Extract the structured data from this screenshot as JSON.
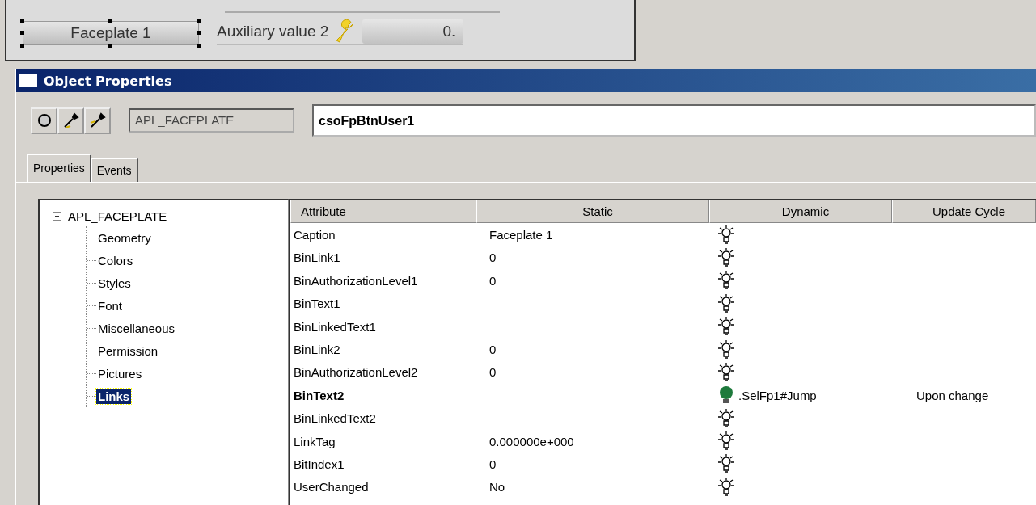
{
  "canvas": {
    "button": "Faceplate 1",
    "aux_label": "Auxiliary value 2",
    "aux_value": "0."
  },
  "window": {
    "title": "Object Properties"
  },
  "toolbar": {
    "type_field": "APL_FACEPLATE",
    "name_field": "csoFpBtnUser1"
  },
  "tabs": [
    {
      "label": "Properties",
      "selected": true
    },
    {
      "label": "Events",
      "selected": false
    }
  ],
  "tree": {
    "label": "APL_FACEPLATE",
    "expanded": true,
    "children": [
      {
        "label": "Geometry",
        "selected": false
      },
      {
        "label": "Colors",
        "selected": false
      },
      {
        "label": "Styles",
        "selected": false
      },
      {
        "label": "Font",
        "selected": false
      },
      {
        "label": "Miscellaneous",
        "selected": false
      },
      {
        "label": "Permission",
        "selected": false
      },
      {
        "label": "Pictures",
        "selected": false
      },
      {
        "label": "Links",
        "selected": true
      }
    ]
  },
  "table": {
    "columns": [
      "Attribute",
      "Static",
      "Dynamic",
      "Update Cycle"
    ],
    "rows": [
      {
        "attribute": "Caption",
        "static": "Faceplate 1",
        "linked": false
      },
      {
        "attribute": "BinLink1",
        "static": "0",
        "linked": false
      },
      {
        "attribute": "BinAuthorizationLevel1",
        "static": "0",
        "linked": false
      },
      {
        "attribute": "BinText1",
        "linked": false
      },
      {
        "attribute": "BinLinkedText1",
        "linked": false
      },
      {
        "attribute": "BinLink2",
        "static": "0",
        "linked": false
      },
      {
        "attribute": "BinAuthorizationLevel2",
        "static": "0",
        "linked": false
      },
      {
        "attribute": "BinText2",
        "linked": true,
        "dynamic": ".SelFp1#Jump",
        "update_cycle": "Upon change"
      },
      {
        "attribute": "BinLinkedText2",
        "linked": false
      },
      {
        "attribute": "LinkTag",
        "static": "0.000000e+000",
        "linked": false
      },
      {
        "attribute": "BitIndex1",
        "static": "0",
        "linked": false
      },
      {
        "attribute": "UserChanged",
        "static": "No",
        "linked": false
      }
    ]
  }
}
